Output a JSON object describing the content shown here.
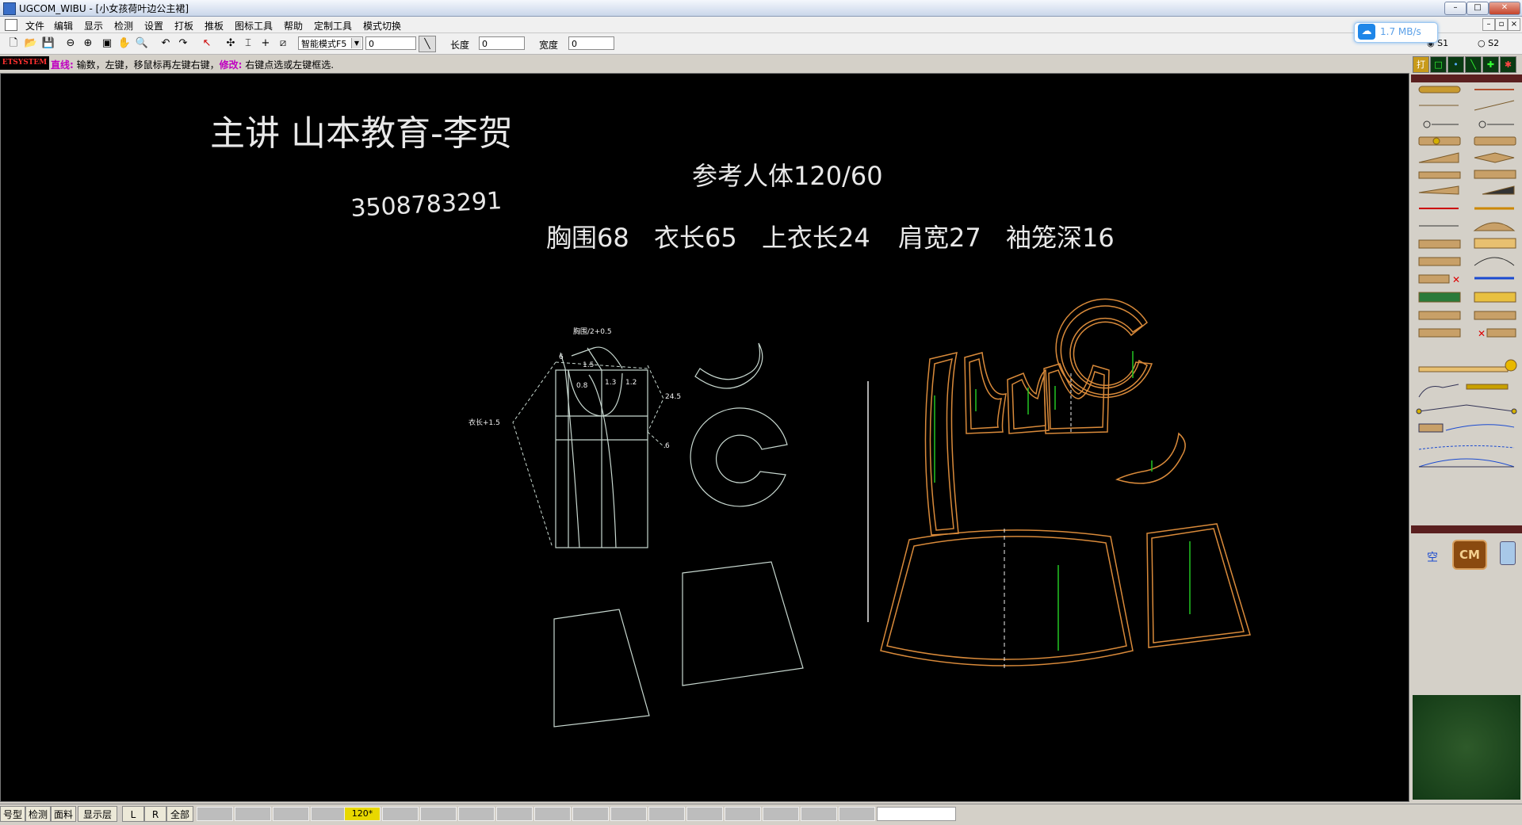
{
  "window": {
    "title": "UGCOM_WIBU  - [小女孩荷叶边公主裙]",
    "controls": {
      "min": "–",
      "max": "□",
      "close": "✕"
    },
    "mdi_controls": {
      "min": "–",
      "restore": "▫",
      "close": "×"
    }
  },
  "menu": [
    "文件",
    "编辑",
    "显示",
    "检测",
    "设置",
    "打板",
    "推板",
    "图标工具",
    "帮助",
    "定制工具",
    "模式切换"
  ],
  "toolbar": {
    "mode_select": "智能模式F5",
    "input_value": "0",
    "length_label": "长度",
    "length_value": "0",
    "width_label": "宽度",
    "width_value": "0",
    "s1": "S1",
    "s2": "S2"
  },
  "network": {
    "speed": "1.7 MB/s"
  },
  "status": {
    "brand": "ETSYSTEM",
    "tool": "直线:",
    "hint1": " 输数，左键，移鼠标再左键右键，",
    "modify": "修改:",
    "hint2": " 右键点选或左键框选."
  },
  "canvas": {
    "lecturer": "主讲    山本教育-李贺",
    "phone": "3508783291",
    "reference": "参考人体120/60",
    "measurements": [
      "胸围68",
      "衣长65",
      "上衣长24",
      "肩宽27",
      "袖笼深16"
    ],
    "draft_labels": {
      "bust": "胸围/2+0.5",
      "length": "衣长+1.5",
      "n6": "6",
      "n15": "1.5",
      "n08": "0.8",
      "n13": "1.3",
      "n12": "1.2",
      "n245": "24.5",
      "n6b": "6"
    },
    "colors": {
      "draft": "#c8d8d0",
      "pieces": "#d98a3a",
      "grain": "#22c522"
    }
  },
  "right_panel": {
    "top_buttons": [
      "打",
      "□",
      "•",
      "╲",
      "✚",
      "✱"
    ],
    "calc_labels": {
      "kong": "空",
      "cm": "CM"
    }
  },
  "bottom": {
    "tabs": [
      "号型",
      "检测",
      "面料",
      "显示层",
      "L",
      "R",
      "全部"
    ],
    "active_slot": "120*"
  }
}
